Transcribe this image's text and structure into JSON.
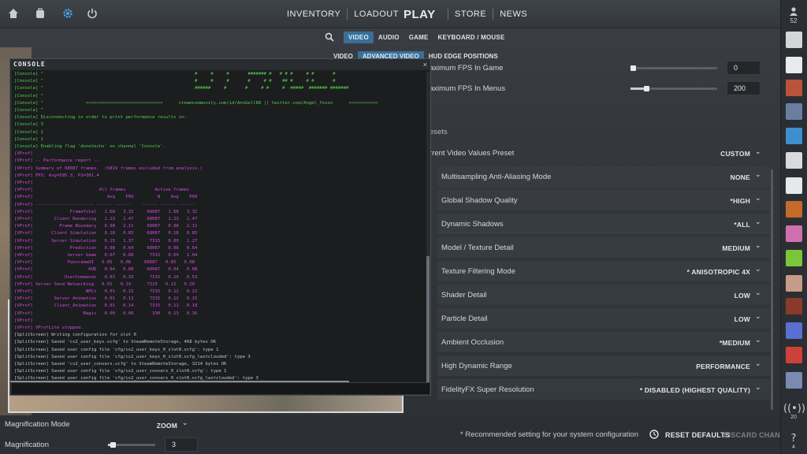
{
  "topbar": {
    "icons": [
      "home-icon",
      "inventory-bag-icon",
      "gear-icon",
      "power-icon"
    ],
    "nav": {
      "inventory": "INVENTORY",
      "loadout": "LOADOUT",
      "play": "PLAY",
      "store": "STORE",
      "news": "NEWS"
    }
  },
  "settings_nav": {
    "search_icon": "search-icon",
    "tabs": [
      "VIDEO",
      "AUDIO",
      "GAME",
      "KEYBOARD / MOUSE"
    ],
    "active_tab": "VIDEO",
    "subtabs": [
      "VIDEO",
      "ADVANCED VIDEO",
      "HUD EDGE POSITIONS"
    ],
    "active_subtab": "ADVANCED VIDEO"
  },
  "fps": {
    "game_label": "aximum FPS In Game",
    "game_value": "0",
    "game_level": 0.0,
    "menu_label": "aximum FPS In Menus",
    "menu_value": "200",
    "menu_level": 0.18
  },
  "presets": {
    "section_label": "esets",
    "current_label": "rrent Video Values Preset",
    "current_value": "CUSTOM"
  },
  "options": [
    {
      "label": "Multisampling Anti-Aliasing Mode",
      "value": "NONE"
    },
    {
      "label": "Global Shadow Quality",
      "value": "*HIGH"
    },
    {
      "label": "Dynamic Shadows",
      "value": "*ALL"
    },
    {
      "label": "Model / Texture Detail",
      "value": "MEDIUM"
    },
    {
      "label": "Texture Filtering Mode",
      "value": "* ANISOTROPIC 4X"
    },
    {
      "label": "Shader Detail",
      "value": "LOW"
    },
    {
      "label": "Particle Detail",
      "value": "LOW"
    },
    {
      "label": "Ambient Occlusion",
      "value": "*MEDIUM"
    },
    {
      "label": "High Dynamic Range",
      "value": "PERFORMANCE"
    },
    {
      "label": "FidelityFX Super Resolution",
      "value": "* DISABLED (HIGHEST QUALITY)"
    }
  ],
  "bottom": {
    "magnification_mode_label": "Magnification Mode",
    "magnification_mode_value": "ZOOM",
    "magnification_label": "Magnification",
    "magnification_value": "3",
    "magnification_level": 0.1,
    "note": "* Recommended setting for your system configuration",
    "reset": "RESET DEFAULTS",
    "discard": "DISCARD CHANGES"
  },
  "friends": {
    "top_count": "52",
    "bottom_count_1": "20",
    "bottom_count_2": "4",
    "avatar_colors": [
      "#d4d7da",
      "#e8eaec",
      "#b8543a",
      "#6a7fa0",
      "#3e8fd0",
      "#d8dadd",
      "#e6e8ea",
      "#c46a2a",
      "#d06fb0",
      "#7ac63a",
      "#c89a8a",
      "#8a3a2a",
      "#5a6fd0",
      "#d0403a",
      "#7a8ab0"
    ]
  },
  "console": {
    "title": "CONSOLE",
    "close": "×",
    "lines": [
      {
        "c": "g",
        "t": "[Console] \"                                                         #     #     #       ####### #   # # #     # #       #"
      },
      {
        "c": "g",
        "t": "[Console] \"                                                         #     #     #       #     # #    ## #     # #       #"
      },
      {
        "c": "g",
        "t": "[Console] \"                                                         ######     #       #     # #     #  #####  ####### #######"
      },
      {
        "c": "g",
        "t": "[Console] \""
      },
      {
        "c": "g",
        "t": "[Console] \"                >>>>>>>>>>>>>>>>>>>>>>>>>>>>>      steamcommunity.com/id/AnnGell88 || twitter.com/Angel_foxxo      <<<<<<<<<<<"
      },
      {
        "c": "g",
        "t": "[Console] \""
      },
      {
        "c": "g",
        "t": "[Console] Disconnecting in order to print performance results in:"
      },
      {
        "c": "g",
        "t": "[Console] 3"
      },
      {
        "c": "g",
        "t": "[Console] 2"
      },
      {
        "c": "g",
        "t": "[Console] 1"
      },
      {
        "c": "g",
        "t": "[Console] Enabling flag 'donotecho' on channel 'Console'."
      },
      {
        "c": "m",
        "t": "[VProf]"
      },
      {
        "c": "m",
        "t": "[VProf] -- Performance report --"
      },
      {
        "c": "m",
        "t": "[VProf] Summary of 68087 frames.  (5819 frames excluded from analysis.)"
      },
      {
        "c": "m",
        "t": "[VProf] FPS: Avg=595.3, P1=301.4"
      },
      {
        "c": "m",
        "t": "[VProf]"
      },
      {
        "c": "m",
        "t": "[VProf]                         All frames           Active frames"
      },
      {
        "c": "m",
        "t": "[VProf]                            Avg    P99         N    Avg    P99"
      },
      {
        "c": "m",
        "t": "[VProf] ---------------------- ------ ------    ------ ------ ------"
      },
      {
        "c": "m",
        "t": "[VProf]              FrameTotal   1.68   3.32     68087   1.68   3.32"
      },
      {
        "c": "m",
        "t": "[VProf]        Client Rendering   1.23   2.47     68087   1.23   2.47"
      },
      {
        "c": "m",
        "t": "[VProf]          Frame Boundary   0.98   2.11     68087   0.98   2.11"
      },
      {
        "c": "m",
        "t": "[VProf]       Client Simulation   0.18   0.85     68087   0.18   0.85"
      },
      {
        "c": "m",
        "t": "[VProf]       Server Simulation   0.15   1.37      7315   0.89   1.27"
      },
      {
        "c": "m",
        "t": "[VProf]              Prediction   0.08   0.64     68087   0.08   0.64"
      },
      {
        "c": "m",
        "t": "[VProf]             Server Game   0.07   0.88      7315   0.69   1.04"
      },
      {
        "c": "m",
        "t": "[VProf]             PanoramaUI   0.05   0.08     68087   0.05   0.08"
      },
      {
        "c": "m",
        "t": "[VProf]                     HUD   0.04   0.08     68087   0.04   0.08"
      },
      {
        "c": "m",
        "t": "[VProf]            UserCommands   0.03   0.33      7315   0.29   0.53"
      },
      {
        "c": "m",
        "t": "[VProf] Server Send Networking   0.01   0.14      7315   0.12   0.20"
      },
      {
        "c": "m",
        "t": "[VProf]                    NPCs   0.01   0.15      7315   0.12   0.22"
      },
      {
        "c": "m",
        "t": "[VProf]        Server Animation   0.01   0.13      7315   0.12   0.15"
      },
      {
        "c": "m",
        "t": "[VProf]        Client_Animation   0.01   0.14      7315   0.11   0.18"
      },
      {
        "c": "m",
        "t": "[VProf]                   Magic   0.00   0.00       330   0.13   0.36"
      },
      {
        "c": "m",
        "t": "[VProf]"
      },
      {
        "c": "m",
        "t": "[VProf] VProfLite stopped."
      },
      {
        "c": "w",
        "t": "[SplitScreen] Writing configuration for slot 0"
      },
      {
        "c": "w",
        "t": "[SplitScreen] Saved 'cs2_user_keys.vcfg' to SteamRemoteStorage, 468 bytes OK"
      },
      {
        "c": "w",
        "t": "[SplitScreen] Saved user config file 'cfg/cs2_user_keys_0_slot0.vcfg': type 1"
      },
      {
        "c": "w",
        "t": "[SplitScreen] Saved user config file 'cfg/cs2_user_keys_0_slot0.vcfg_lastclouded': type 3"
      },
      {
        "c": "w",
        "t": "[SplitScreen] Saved 'cs2_user_convars.vcfg' to SteamRemoteStorage, 3214 bytes OK"
      },
      {
        "c": "w",
        "t": "[SplitScreen] Saved user config file 'cfg/cs2_user_convars_0_slot0.vcfg': type 1"
      },
      {
        "c": "w",
        "t": "[SplitScreen] Saved user config file 'cfg/cs2_user_convars_0_slot0.vcfg_lastclouded': type 3"
      }
    ]
  }
}
